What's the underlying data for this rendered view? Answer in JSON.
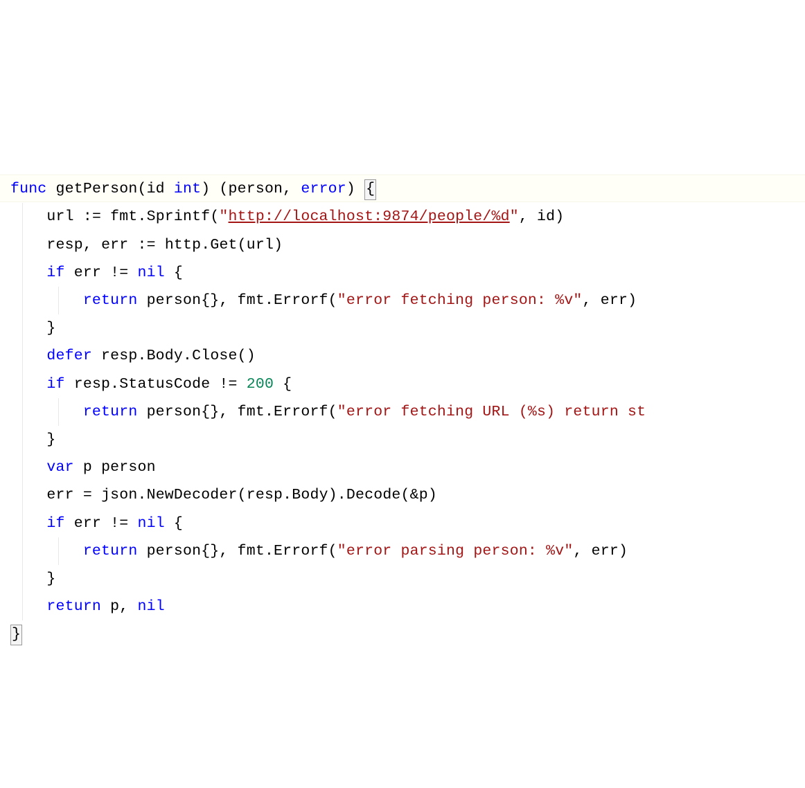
{
  "code": {
    "l1": {
      "func": "func",
      "name": "getPerson",
      "lparen1": "(",
      "param1": "id",
      "type1": "int",
      "rparen1": ")",
      "lparen2": "(",
      "ret1": "person",
      "comma": ",",
      "ret2": "error",
      "rparen2": ")",
      "obrace": "{"
    },
    "l2": {
      "v1": "url",
      "op": ":=",
      "pkg": "fmt",
      "dot": ".",
      "fn": "Sprintf",
      "lp": "(",
      "q1": "\"",
      "url": "http://localhost:9874/people/%d",
      "q2": "\"",
      "comma": ",",
      "arg2": "id",
      "rp": ")"
    },
    "l3": {
      "v1": "resp",
      "comma": ",",
      "v2": "err",
      "op": ":=",
      "pkg": "http",
      "dot": ".",
      "fn": "Get",
      "lp": "(",
      "arg": "url",
      "rp": ")"
    },
    "l4": {
      "if": "if",
      "v": "err",
      "op": "!=",
      "nil": "nil",
      "obrace": "{"
    },
    "l5": {
      "ret": "return",
      "pt": "person",
      "ob": "{",
      "cb": "}",
      "comma": ",",
      "pkg": "fmt",
      "dot": ".",
      "fn": "Errorf",
      "lp": "(",
      "s": "\"error fetching person: %v\"",
      "comma2": ",",
      "arg": "err",
      "rp": ")"
    },
    "l6": {
      "cbrace": "}"
    },
    "l7": {
      "defer": "defer",
      "v": "resp",
      "dot1": ".",
      "f1": "Body",
      "dot2": ".",
      "f2": "Close",
      "lp": "(",
      "rp": ")"
    },
    "l8": {
      "if": "if",
      "v": "resp",
      "dot": ".",
      "f": "StatusCode",
      "op": "!=",
      "num": "200",
      "obrace": "{"
    },
    "l9": {
      "ret": "return",
      "pt": "person",
      "ob": "{",
      "cb": "}",
      "comma": ",",
      "pkg": "fmt",
      "dot": ".",
      "fn": "Errorf",
      "lp": "(",
      "s": "\"error fetching URL (%s) return st"
    },
    "l10": {
      "cbrace": "}"
    },
    "l11": {
      "var": "var",
      "n": "p",
      "t": "person"
    },
    "l12": {
      "v": "err",
      "op": "=",
      "pkg": "json",
      "dot": ".",
      "fn": "NewDecoder",
      "lp": "(",
      "a1": "resp",
      "dot2": ".",
      "a2": "Body",
      "rp": ")",
      "dot3": ".",
      "fn2": "Decode",
      "lp2": "(",
      "amp": "&",
      "a3": "p",
      "rp2": ")"
    },
    "l13": {
      "if": "if",
      "v": "err",
      "op": "!=",
      "nil": "nil",
      "obrace": "{"
    },
    "l14": {
      "ret": "return",
      "pt": "person",
      "ob": "{",
      "cb": "}",
      "comma": ",",
      "pkg": "fmt",
      "dot": ".",
      "fn": "Errorf",
      "lp": "(",
      "s": "\"error parsing person: %v\"",
      "comma2": ",",
      "arg": "err",
      "rp": ")"
    },
    "l15": {
      "cbrace": "}"
    },
    "l16": {
      "ret": "return",
      "v1": "p",
      "comma": ",",
      "nil": "nil"
    },
    "l17": {
      "cbrace": "}"
    }
  }
}
